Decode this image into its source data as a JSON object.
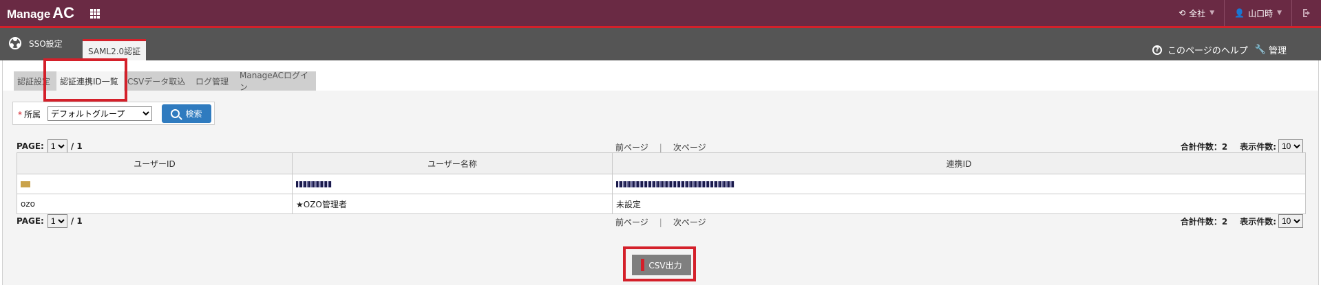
{
  "header": {
    "brand_manage": "Manage",
    "brand_ac": "AC",
    "scope": "全社",
    "user": "山口時",
    "grid_icon": "apps-grid-icon",
    "logout_icon": "logout-icon"
  },
  "subheader": {
    "section": "SSO設定",
    "active_tab": "SAML2.0認証",
    "help": "このページのヘルプ",
    "admin": "管理"
  },
  "tabs": [
    {
      "label": "認証設定",
      "active": false
    },
    {
      "label": "認証連携ID一覧",
      "active": true
    },
    {
      "label": "CSVデータ取込",
      "active": false
    },
    {
      "label": "ログ管理",
      "active": false
    },
    {
      "label": "ManageACログイン",
      "active": false
    }
  ],
  "search": {
    "required_mark": "*",
    "label": "所属",
    "selected": "デフォルトグループ",
    "button": "検索"
  },
  "pager": {
    "page_label": "PAGE:",
    "page": "1",
    "total_pages": "/ 1",
    "prev": "前ページ",
    "next": "次ページ",
    "total_label": "合計件数：2",
    "per_page_label": "表示件数:",
    "per_page": "10"
  },
  "table": {
    "headers": [
      "ユーザーID",
      "ユーザー名称",
      "連携ID"
    ],
    "rows": [
      [
        "",
        "",
        ""
      ],
      [
        "ozo",
        "★OZO管理者",
        "未設定"
      ]
    ]
  },
  "csv_button": "CSV出力",
  "colors": {
    "topbar": "#6a2a44",
    "accent_red": "#d4202a",
    "subbar": "#555555",
    "search_button": "#2f7bbf"
  }
}
